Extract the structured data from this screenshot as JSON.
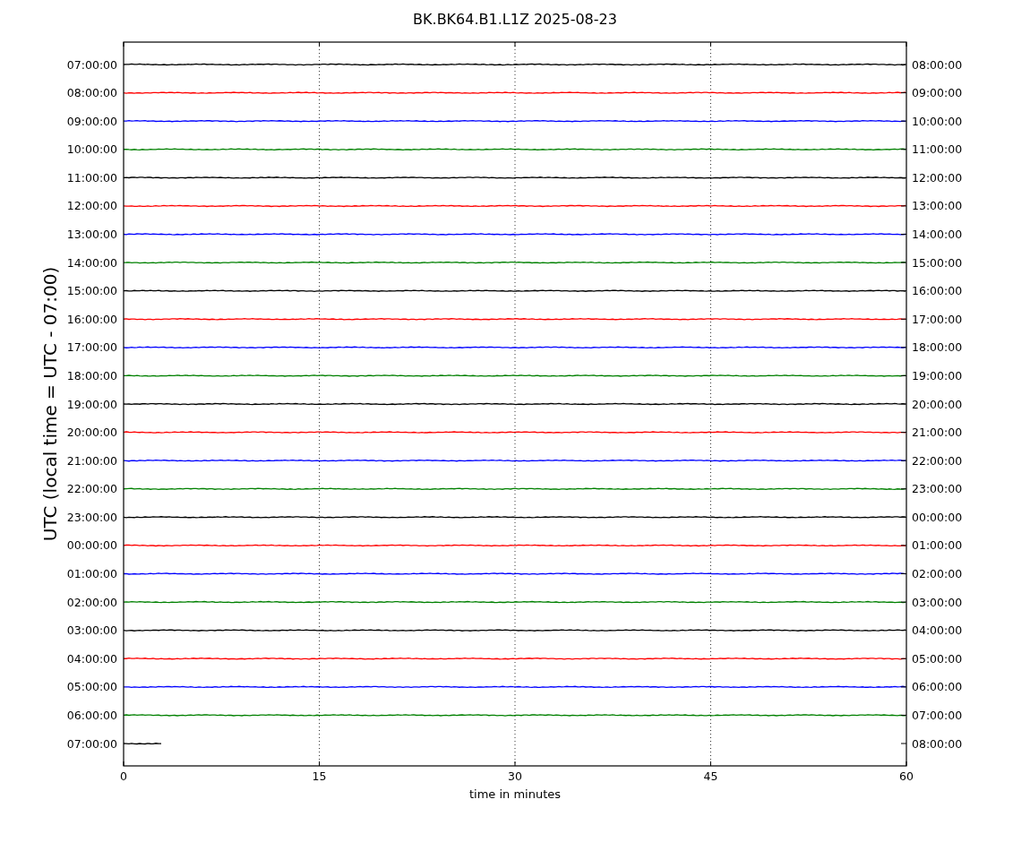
{
  "title": "BK.BK64.B1.L1Z 2025-08-23",
  "ylabel": "UTC (local time = UTC - 07:00)",
  "xlabel": "time in minutes",
  "xticks": [
    "0",
    "15",
    "30",
    "45",
    "60"
  ],
  "traces": [
    {
      "left": "07:00:00",
      "right": "08:00:00",
      "color": "#000000",
      "level": 1
    },
    {
      "left": "08:00:00",
      "right": "09:00:00",
      "color": "#ff0000",
      "level": 1
    },
    {
      "left": "09:00:00",
      "right": "10:00:00",
      "color": "#0000ff",
      "level": 1
    },
    {
      "left": "10:00:00",
      "right": "11:00:00",
      "color": "#008000",
      "level": 1
    },
    {
      "left": "11:00:00",
      "right": "12:00:00",
      "color": "#000000",
      "level": 1
    },
    {
      "left": "12:00:00",
      "right": "13:00:00",
      "color": "#ff0000",
      "level": 1
    },
    {
      "left": "13:00:00",
      "right": "14:00:00",
      "color": "#0000ff",
      "level": 1
    },
    {
      "left": "14:00:00",
      "right": "15:00:00",
      "color": "#008000",
      "level": 1
    },
    {
      "left": "15:00:00",
      "right": "16:00:00",
      "color": "#000000",
      "level": 1
    },
    {
      "left": "16:00:00",
      "right": "17:00:00",
      "color": "#ff0000",
      "level": 1
    },
    {
      "left": "17:00:00",
      "right": "18:00:00",
      "color": "#0000ff",
      "level": 1
    },
    {
      "left": "18:00:00",
      "right": "19:00:00",
      "color": "#008000",
      "level": 1
    },
    {
      "left": "19:00:00",
      "right": "20:00:00",
      "color": "#000000",
      "level": 1
    },
    {
      "left": "20:00:00",
      "right": "21:00:00",
      "color": "#ff0000",
      "level": 1
    },
    {
      "left": "21:00:00",
      "right": "22:00:00",
      "color": "#0000ff",
      "level": 1
    },
    {
      "left": "22:00:00",
      "right": "23:00:00",
      "color": "#008000",
      "level": 1
    },
    {
      "left": "23:00:00",
      "right": "00:00:00",
      "color": "#000000",
      "level": 1
    },
    {
      "left": "00:00:00",
      "right": "01:00:00",
      "color": "#ff0000",
      "level": 1
    },
    {
      "left": "01:00:00",
      "right": "02:00:00",
      "color": "#0000ff",
      "level": 1
    },
    {
      "left": "02:00:00",
      "right": "03:00:00",
      "color": "#008000",
      "level": 1
    },
    {
      "left": "03:00:00",
      "right": "04:00:00",
      "color": "#000000",
      "level": 1
    },
    {
      "left": "04:00:00",
      "right": "05:00:00",
      "color": "#ff0000",
      "level": 1
    },
    {
      "left": "05:00:00",
      "right": "06:00:00",
      "color": "#0000ff",
      "level": 1
    },
    {
      "left": "06:00:00",
      "right": "07:00:00",
      "color": "#008000",
      "level": 1
    },
    {
      "left": "07:00:00",
      "right": "08:00:00",
      "color": "#000000",
      "level": 0.05
    }
  ]
}
